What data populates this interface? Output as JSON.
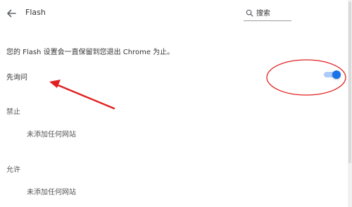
{
  "header": {
    "title": "Flash",
    "back_icon": "arrow-left-icon",
    "search": {
      "icon": "search-icon",
      "placeholder": "搜索",
      "value": ""
    }
  },
  "description": "您的 Flash 设置会一直保留到您退出 Chrome 为止。",
  "ask_first": {
    "label": "先询问",
    "enabled": true,
    "accent_color": "#1a73e8"
  },
  "sections": {
    "block": {
      "heading": "禁止",
      "empty_text": "未添加任何网站"
    },
    "allow": {
      "heading": "允许",
      "empty_text": "未添加任何网站"
    }
  },
  "annotations": {
    "color": "#e02020",
    "shapes": [
      "ellipse-around-toggle",
      "arrow-to-label"
    ]
  }
}
